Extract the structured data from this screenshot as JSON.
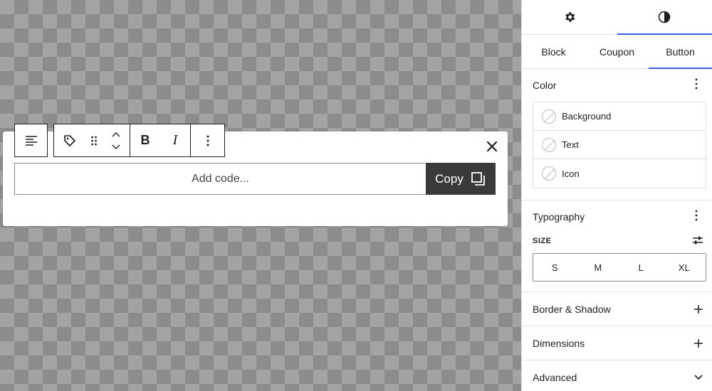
{
  "editor": {
    "code_placeholder": "Add code...",
    "copy_label": "Copy"
  },
  "toolbar": {
    "bold_label": "B",
    "italic_label": "I"
  },
  "sidebar": {
    "sub_tabs": [
      "Block",
      "Coupon",
      "Button"
    ],
    "active_sub_tab": "Button",
    "color": {
      "title": "Color",
      "items": [
        "Background",
        "Text",
        "Icon"
      ]
    },
    "typography": {
      "title": "Typography",
      "size_label": "SIZE",
      "sizes": [
        "S",
        "M",
        "L",
        "XL"
      ]
    },
    "border_shadow": {
      "title": "Border & Shadow"
    },
    "dimensions": {
      "title": "Dimensions"
    },
    "advanced": {
      "title": "Advanced"
    }
  },
  "colors": {
    "accent": "#3858e9",
    "copy_button_bg": "#3a3a3a"
  },
  "icons": {
    "top_tab_settings": "gear-icon",
    "top_tab_styles": "contrast-icon",
    "align": "align-left-icon",
    "coupon": "tag-icon",
    "drag": "drag-handle-icon",
    "move": "chevron-up-down-icon",
    "options": "more-vertical-icon",
    "close": "close-icon",
    "copy": "copy-icon"
  }
}
